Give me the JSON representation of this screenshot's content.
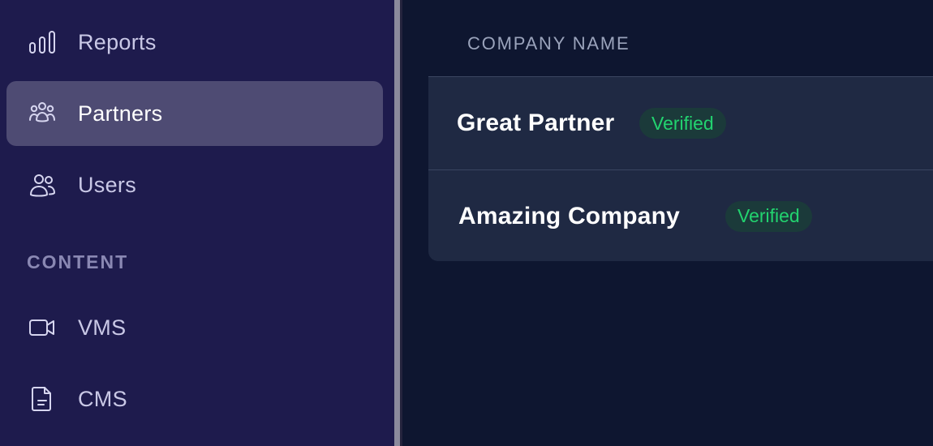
{
  "sidebar": {
    "items": [
      {
        "label": "Reports",
        "icon": "bar-chart-icon",
        "active": false
      },
      {
        "label": "Partners",
        "icon": "partners-icon",
        "active": true
      },
      {
        "label": "Users",
        "icon": "users-icon",
        "active": false
      }
    ],
    "section_label": "CONTENT",
    "content_items": [
      {
        "label": "VMS",
        "icon": "video-camera-icon"
      },
      {
        "label": "CMS",
        "icon": "document-icon"
      }
    ]
  },
  "table": {
    "column_header": "COMPANY NAME",
    "rows": [
      {
        "company": "Great Partner",
        "status": "Verified"
      },
      {
        "company": "Amazing Company",
        "status": "Verified"
      }
    ]
  },
  "colors": {
    "sidebar_bg": "#1e1b4d",
    "active_item_bg": "#4e4b73",
    "main_bg": "#0e1630",
    "table_bg": "#1f2943",
    "verified_text": "#22d36f",
    "verified_bg": "#1b3a3a"
  }
}
